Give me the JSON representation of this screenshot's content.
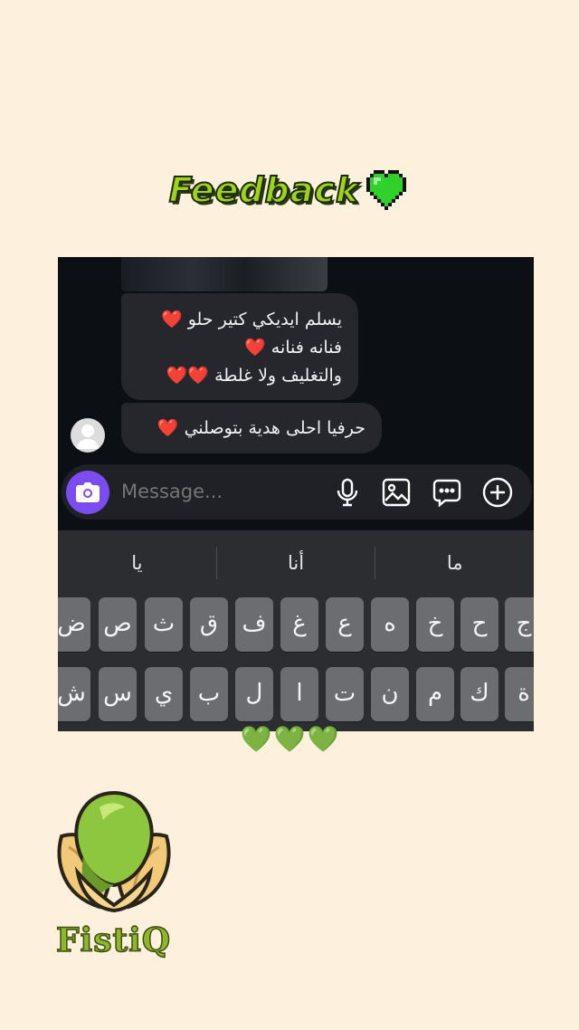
{
  "header": {
    "title": "Feedback",
    "title_icon": "green-pixel-heart-icon"
  },
  "chat": {
    "messages": [
      {
        "lines": [
          "يسلم ايديكي كتير حلو",
          "فنانه فنانه",
          "والتغليف ولا غلطة"
        ],
        "hearts": [
          "❤️",
          "❤️",
          "❤️❤️"
        ]
      },
      {
        "lines": [
          "حرفيا احلى هدية بتوصلني"
        ],
        "hearts": [
          "❤️"
        ]
      }
    ],
    "composer": {
      "placeholder": "Message...",
      "icons": [
        "camera-icon",
        "microphone-icon",
        "gallery-icon",
        "sticker-icon",
        "plus-icon"
      ]
    }
  },
  "keyboard": {
    "suggestions": [
      "يا",
      "أنا",
      "ما"
    ],
    "row1": [
      "ض",
      "ص",
      "ث",
      "ق",
      "ف",
      "غ",
      "ع",
      "ه",
      "خ",
      "ح",
      "ج"
    ],
    "row2": [
      "ش",
      "س",
      "ي",
      "ب",
      "ل",
      "ا",
      "ت",
      "ن",
      "م",
      "ك",
      "ة"
    ]
  },
  "footer": {
    "hearts": [
      "💚",
      "💚",
      "💚"
    ],
    "brand": "FistiQ",
    "logo_icon": "pistachio-logo-icon"
  },
  "colors": {
    "background": "#fdf1de",
    "title_green": "#9ed416",
    "chat_bg": "#0c0f14",
    "bubble": "#25272c",
    "accent_purple": "#7b4df0",
    "heart_red": "#e0232e",
    "heart_green": "#2fc22a"
  }
}
